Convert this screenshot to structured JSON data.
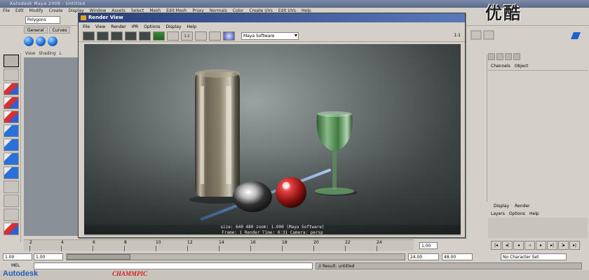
{
  "maya": {
    "title": "Autodesk Maya 2008 - Untitled",
    "menus": [
      "File",
      "Edit",
      "Modify",
      "Create",
      "Display",
      "Window",
      "Assets",
      "Select",
      "Mesh",
      "Edit Mesh",
      "Proxy",
      "Normals",
      "Color",
      "Create UVs",
      "Edit UVs",
      "Help"
    ],
    "mode": "Polygons",
    "shelf_tabs": [
      "General",
      "Curves"
    ],
    "panel_menus": [
      "View",
      "Shading",
      "L"
    ]
  },
  "render_view": {
    "title": "Render View",
    "menus": [
      "File",
      "View",
      "Render",
      "IPR",
      "Options",
      "Display",
      "Help"
    ],
    "renderer": "Maya Software",
    "ratio": "1:1",
    "info_line1": "size:  640  480  zoom: 1.000      (Maya Software)",
    "info_line2": "Frame: 1        Render Time: 0:31      Camera: persp"
  },
  "channel_box": {
    "tabs": [
      "Channels",
      "Object"
    ],
    "layer_tabs": [
      "Display",
      "Render"
    ],
    "layer_menus": [
      "Layers",
      "Options",
      "Help"
    ]
  },
  "timeline": {
    "ticks": [
      "2",
      "4",
      "6",
      "8",
      "10",
      "12",
      "14",
      "16",
      "18",
      "20",
      "22",
      "24"
    ],
    "current": "1.00"
  },
  "range": {
    "start": "1.00",
    "inner_start": "1.00",
    "end": "24.00",
    "outer_end": "48.00",
    "character_set": "No Character Set"
  },
  "command": {
    "mel_label": "MEL",
    "result": "// Result: untitled"
  },
  "branding": {
    "autodesk": "Autodesk",
    "watermark": "CHAMMPIC",
    "top_right": "优酷"
  },
  "colors": {
    "render_bg": "#4a5252",
    "title_bar": "#2a3e78"
  }
}
